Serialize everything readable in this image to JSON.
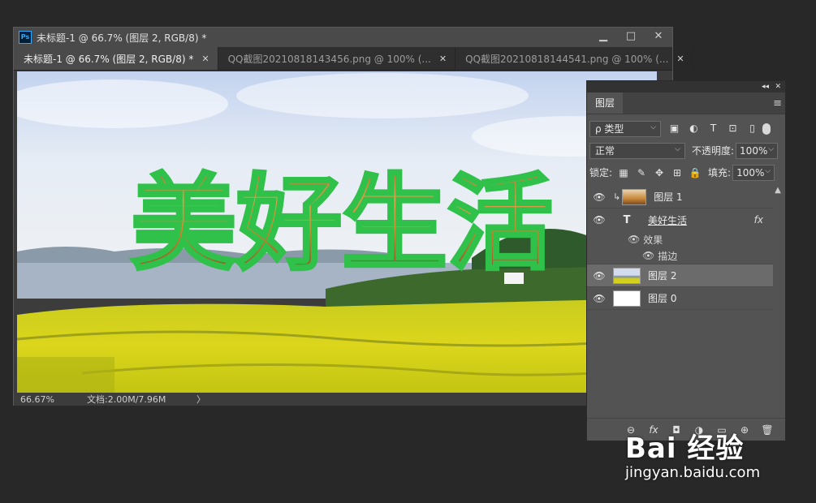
{
  "document": {
    "title": "未标题-1 @ 66.7% (图层 2, RGB/8) *",
    "app_icon_label": "Ps",
    "window_buttons": {
      "minimize": "▁",
      "restore": "□",
      "close": "✕"
    },
    "tabs": [
      {
        "label": "未标题-1 @ 66.7% (图层 2, RGB/8) *",
        "close": "✕",
        "active": true
      },
      {
        "label": "QQ截图20210818143456.png @ 100% (...",
        "close": "✕",
        "active": false
      },
      {
        "label": "QQ截图20210818144541.png @ 100% (...",
        "close": "✕",
        "active": false
      }
    ],
    "canvas_text": "美好生活",
    "status": {
      "zoom": "66.67%",
      "doc_size": "文档:2.00M/7.96M",
      "arrow": "〉"
    }
  },
  "layers_panel": {
    "collapse_icons": "◂◂",
    "close_icon": "✕",
    "tab": "图层",
    "menu_icon": "≡",
    "filter": {
      "label": "ρ 类型",
      "caret": "⌵"
    },
    "filter_icons": [
      "▣",
      "◐",
      "T",
      "⊡",
      "▯"
    ],
    "blend_mode": "正常",
    "opacity_label": "不透明度:",
    "opacity_value": "100%",
    "lock_label": "锁定:",
    "lock_icons": [
      "▦",
      "✎",
      "✥",
      "⊞",
      "🔒"
    ],
    "fill_label": "填充:",
    "fill_value": "100%",
    "layers": [
      {
        "name": "图层 1",
        "type": "image",
        "clipped": true
      },
      {
        "name": "美好生活",
        "type": "text",
        "fx": "fx"
      },
      {
        "name": "效果",
        "type": "effect-group"
      },
      {
        "name": "描边",
        "type": "effect"
      },
      {
        "name": "图层 2",
        "type": "image",
        "selected": true
      },
      {
        "name": "图层 0",
        "type": "image"
      }
    ],
    "bottom_icons": [
      "⊖",
      "fx",
      "◘",
      "◑",
      "▭",
      "⊕",
      "🗑"
    ]
  },
  "watermark": {
    "logo": "Bai 经验",
    "url": "jingyan.baidu.com"
  },
  "colors": {
    "stroke_green": "#2fc14a",
    "sky_top": "#cfd9ef",
    "field_yellow": "#d6d21a",
    "panel_bg": "#535353",
    "app_bg": "#282828"
  }
}
